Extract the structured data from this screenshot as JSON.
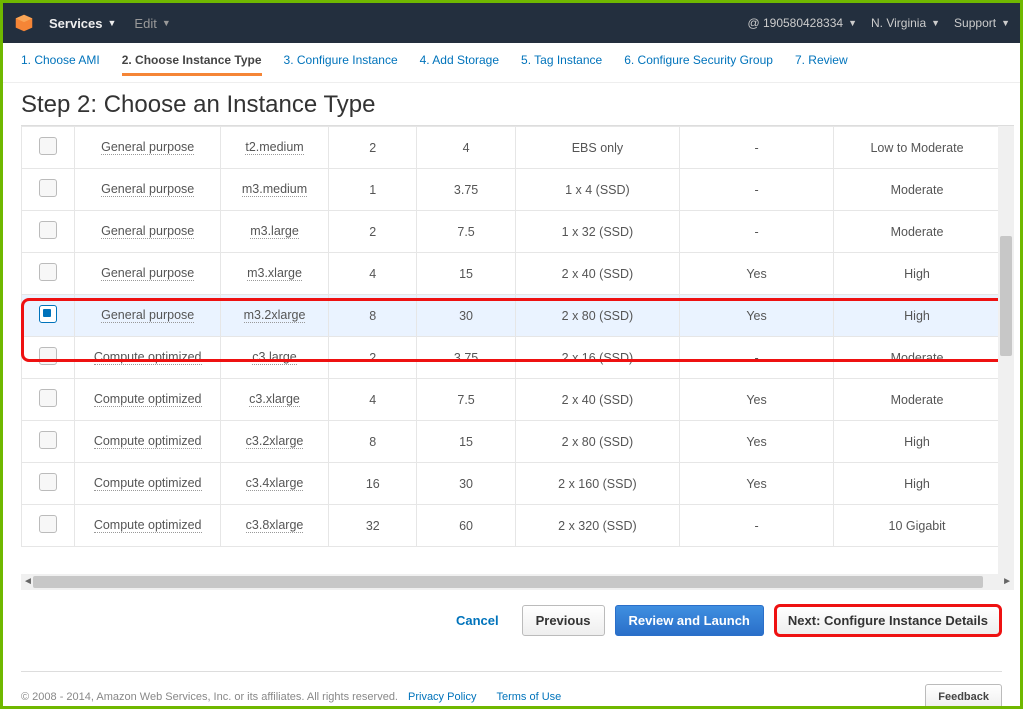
{
  "topbar": {
    "services": "Services",
    "edit": "Edit",
    "account": "@ 190580428334",
    "region": "N. Virginia",
    "support": "Support"
  },
  "wizard": [
    {
      "label": "1. Choose AMI"
    },
    {
      "label": "2. Choose Instance Type",
      "active": true
    },
    {
      "label": "3. Configure Instance"
    },
    {
      "label": "4. Add Storage"
    },
    {
      "label": "5. Tag Instance"
    },
    {
      "label": "6. Configure Security Group"
    },
    {
      "label": "7. Review"
    }
  ],
  "page_title": "Step 2: Choose an Instance Type",
  "rows": [
    {
      "family": "General purpose",
      "type": "t2.medium",
      "vcpu": "2",
      "mem": "4",
      "storage": "EBS only",
      "ebs": "-",
      "net": "Low to Moderate"
    },
    {
      "family": "General purpose",
      "type": "m3.medium",
      "vcpu": "1",
      "mem": "3.75",
      "storage": "1 x 4 (SSD)",
      "ebs": "-",
      "net": "Moderate"
    },
    {
      "family": "General purpose",
      "type": "m3.large",
      "vcpu": "2",
      "mem": "7.5",
      "storage": "1 x 32 (SSD)",
      "ebs": "-",
      "net": "Moderate"
    },
    {
      "family": "General purpose",
      "type": "m3.xlarge",
      "vcpu": "4",
      "mem": "15",
      "storage": "2 x 40 (SSD)",
      "ebs": "Yes",
      "net": "High"
    },
    {
      "family": "General purpose",
      "type": "m3.2xlarge",
      "vcpu": "8",
      "mem": "30",
      "storage": "2 x 80 (SSD)",
      "ebs": "Yes",
      "net": "High",
      "selected": true
    },
    {
      "family": "Compute optimized",
      "type": "c3.large",
      "vcpu": "2",
      "mem": "3.75",
      "storage": "2 x 16 (SSD)",
      "ebs": "-",
      "net": "Moderate"
    },
    {
      "family": "Compute optimized",
      "type": "c3.xlarge",
      "vcpu": "4",
      "mem": "7.5",
      "storage": "2 x 40 (SSD)",
      "ebs": "Yes",
      "net": "Moderate"
    },
    {
      "family": "Compute optimized",
      "type": "c3.2xlarge",
      "vcpu": "8",
      "mem": "15",
      "storage": "2 x 80 (SSD)",
      "ebs": "Yes",
      "net": "High"
    },
    {
      "family": "Compute optimized",
      "type": "c3.4xlarge",
      "vcpu": "16",
      "mem": "30",
      "storage": "2 x 160 (SSD)",
      "ebs": "Yes",
      "net": "High"
    },
    {
      "family": "Compute optimized",
      "type": "c3.8xlarge",
      "vcpu": "32",
      "mem": "60",
      "storage": "2 x 320 (SSD)",
      "ebs": "-",
      "net": "10 Gigabit"
    }
  ],
  "buttons": {
    "cancel": "Cancel",
    "previous": "Previous",
    "review": "Review and Launch",
    "next": "Next: Configure Instance Details"
  },
  "footer": {
    "copyright": "© 2008 - 2014, Amazon Web Services, Inc. or its affiliates. All rights reserved.",
    "privacy": "Privacy Policy",
    "terms": "Terms of Use",
    "feedback": "Feedback"
  }
}
